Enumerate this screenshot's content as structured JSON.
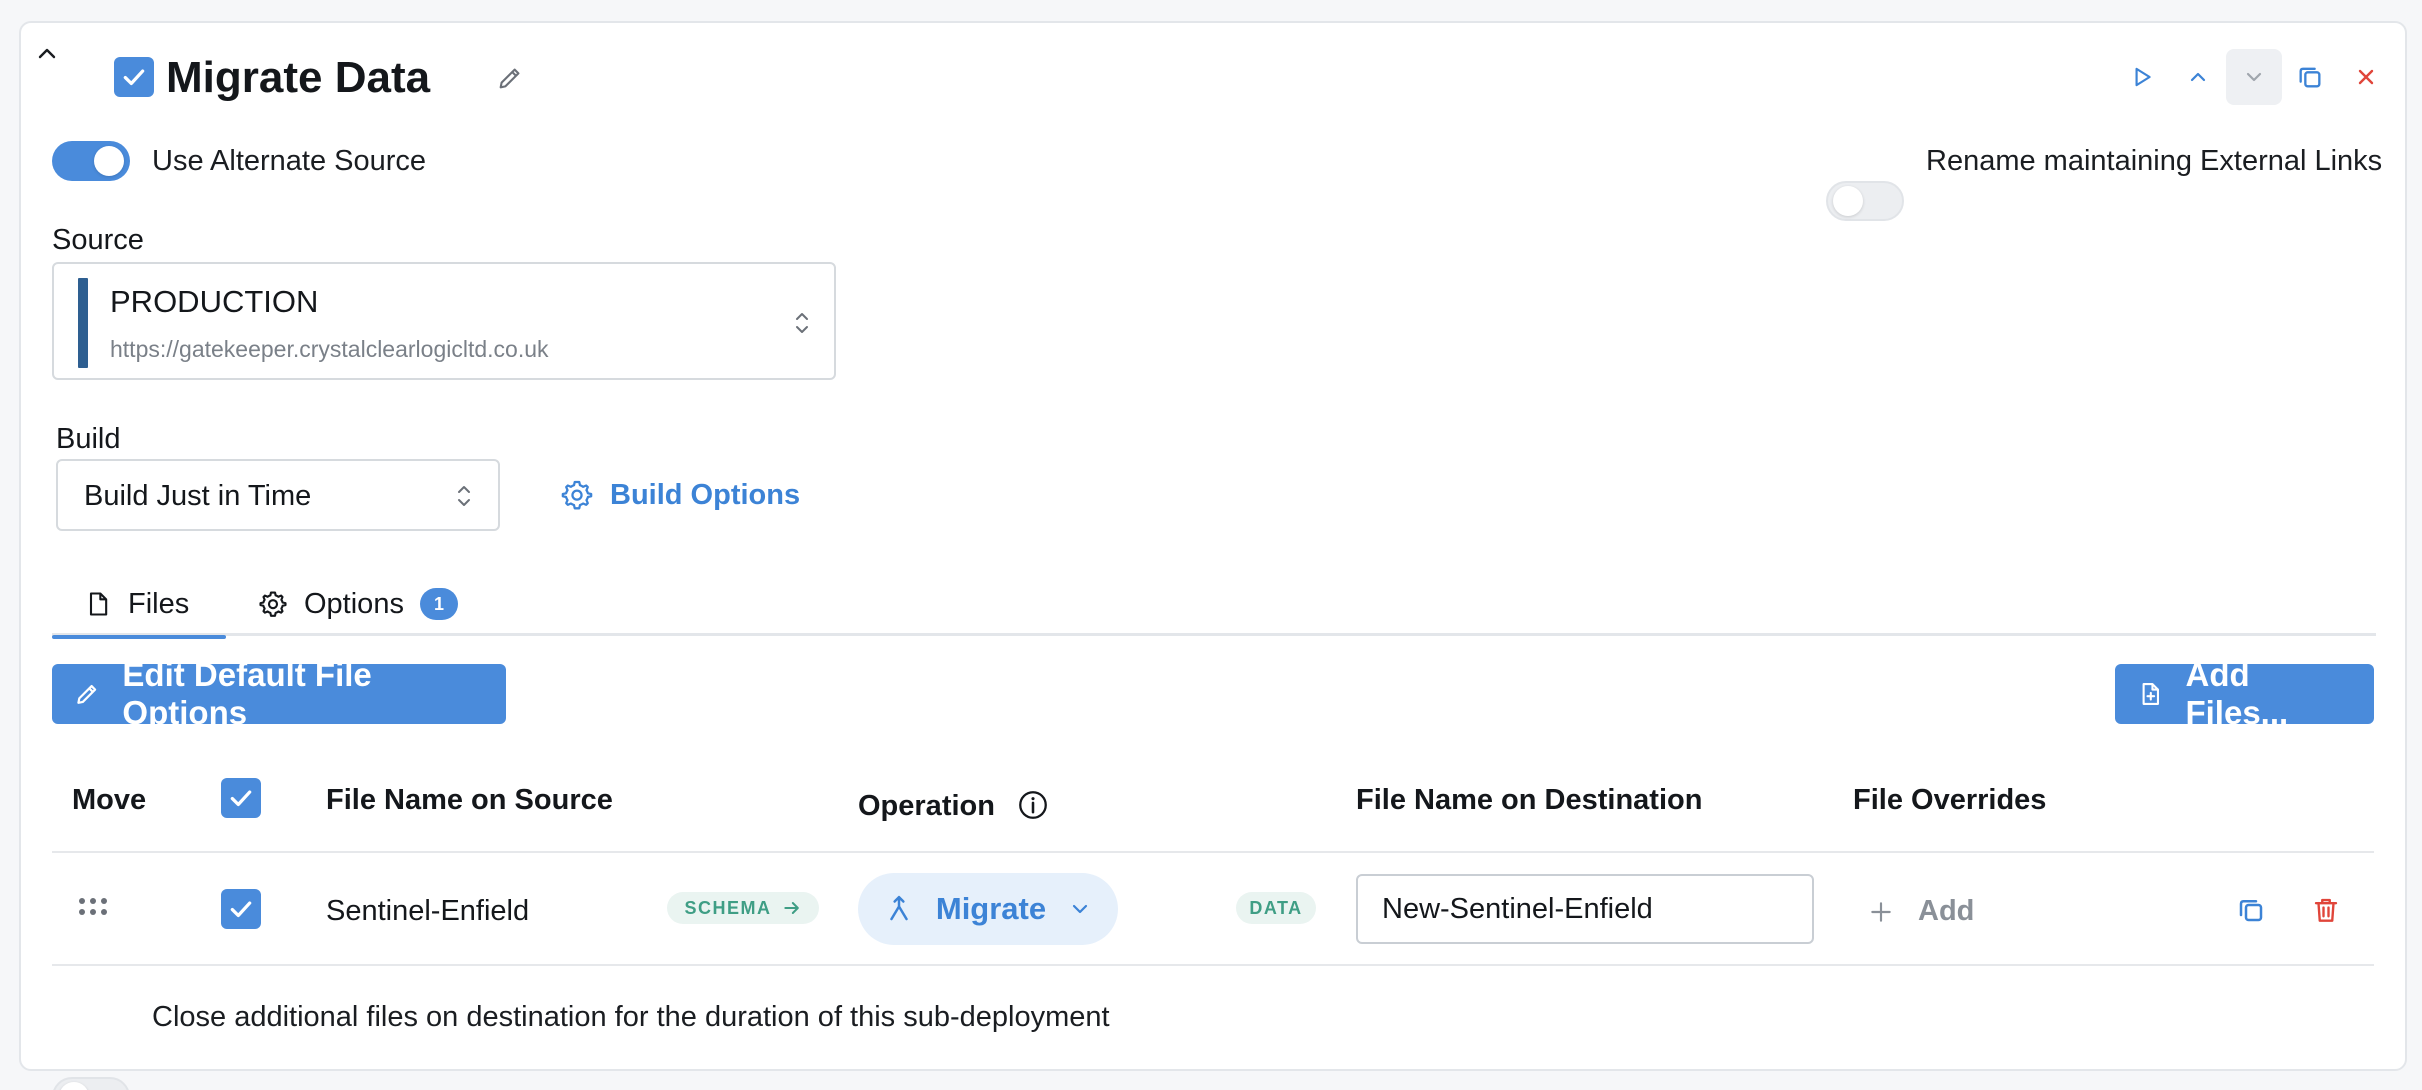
{
  "header": {
    "title": "Migrate Data",
    "enabled": true
  },
  "toggles": {
    "alternate_source": {
      "label": "Use Alternate Source",
      "on": true
    },
    "rename_external_links": {
      "label": "Rename maintaining External Links",
      "on": false
    },
    "close_additional": {
      "label": "Close additional files on destination for the duration of this sub-deployment",
      "on": false
    }
  },
  "source": {
    "label": "Source",
    "name": "PRODUCTION",
    "url": "https://gatekeeper.crystalclearlogicltd.co.uk",
    "color": "#2e5f91"
  },
  "build": {
    "label": "Build",
    "value": "Build Just in Time",
    "options_label": "Build Options"
  },
  "tabs": [
    {
      "label": "Files",
      "active": true
    },
    {
      "label": "Options",
      "badge": "1",
      "active": false
    }
  ],
  "toolbar": {
    "edit_defaults_label": "Edit Default File Options",
    "add_files_label": "Add Files..."
  },
  "table": {
    "columns": {
      "move": "Move",
      "source_name": "File Name on Source",
      "operation": "Operation",
      "dest_name": "File Name on Destination",
      "overrides": "File Overrides"
    },
    "rows": [
      {
        "source_name": "Sentinel-Enfield",
        "schema_tag": "SCHEMA",
        "operation": "Migrate",
        "data_tag": "DATA",
        "dest_name": "New-Sentinel-Enfield",
        "add_override_label": "Add",
        "checked": true
      }
    ]
  },
  "colors": {
    "accent": "#4a8bdb",
    "danger": "#e0453a",
    "tag_green": "#3f9e85"
  }
}
